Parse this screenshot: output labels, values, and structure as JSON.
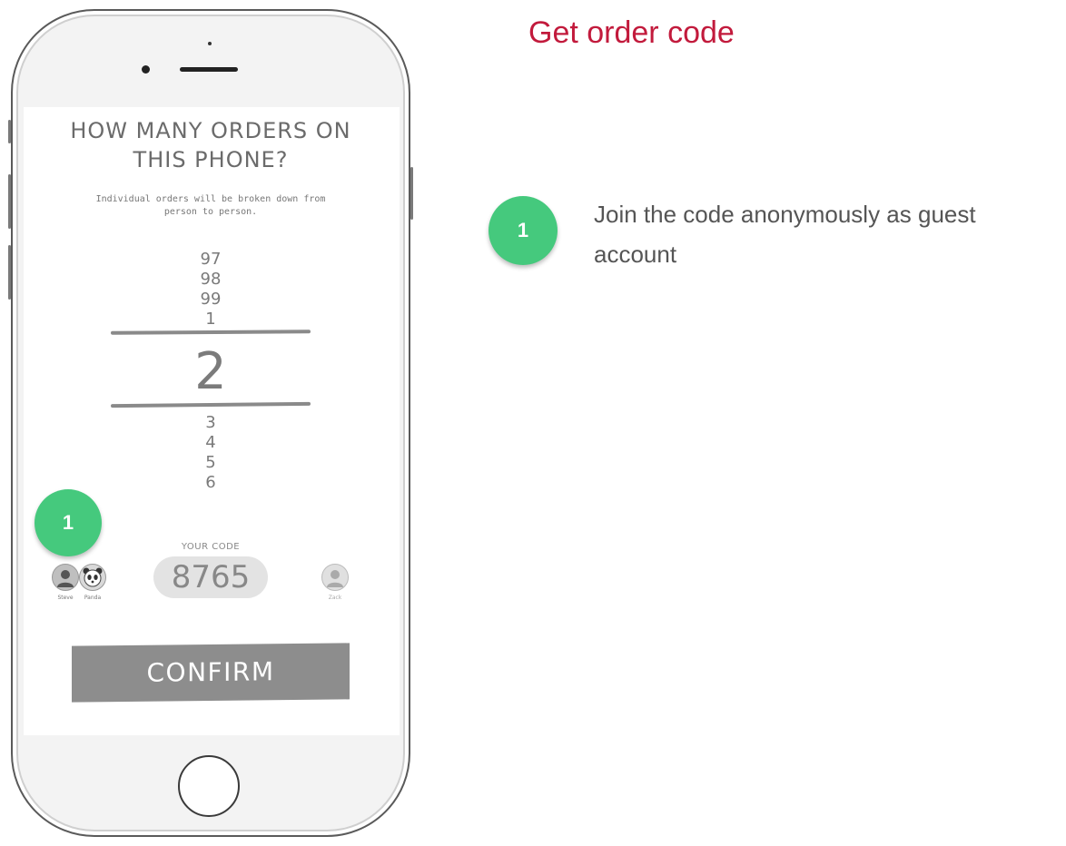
{
  "panel": {
    "title": "Get order code",
    "steps": [
      {
        "number": "1",
        "text": "Join the code anonymously as guest account"
      }
    ]
  },
  "phone_screen": {
    "title_line1": "HOW MANY ORDERS ON",
    "title_line2": "THIS PHONE?",
    "subtitle": "Individual orders will be broken down from person to person.",
    "picker": {
      "above": [
        "97",
        "98",
        "99",
        "1"
      ],
      "selected": "2",
      "below": [
        "3",
        "4",
        "5",
        "6"
      ]
    },
    "step_badge": "1",
    "members": [
      {
        "name": "Steve",
        "icon": "person-avatar-icon"
      },
      {
        "name": "Panda",
        "icon": "panda-avatar-icon"
      }
    ],
    "your_code_label": "YOUR CODE",
    "code": "8765",
    "guest": {
      "name": "Zack",
      "icon": "person-avatar-icon"
    },
    "confirm_label": "CONFIRM"
  },
  "colors": {
    "accent_green": "#45c97d",
    "title_red": "#c21a3c",
    "confirm_gray": "#8d8d8d"
  }
}
